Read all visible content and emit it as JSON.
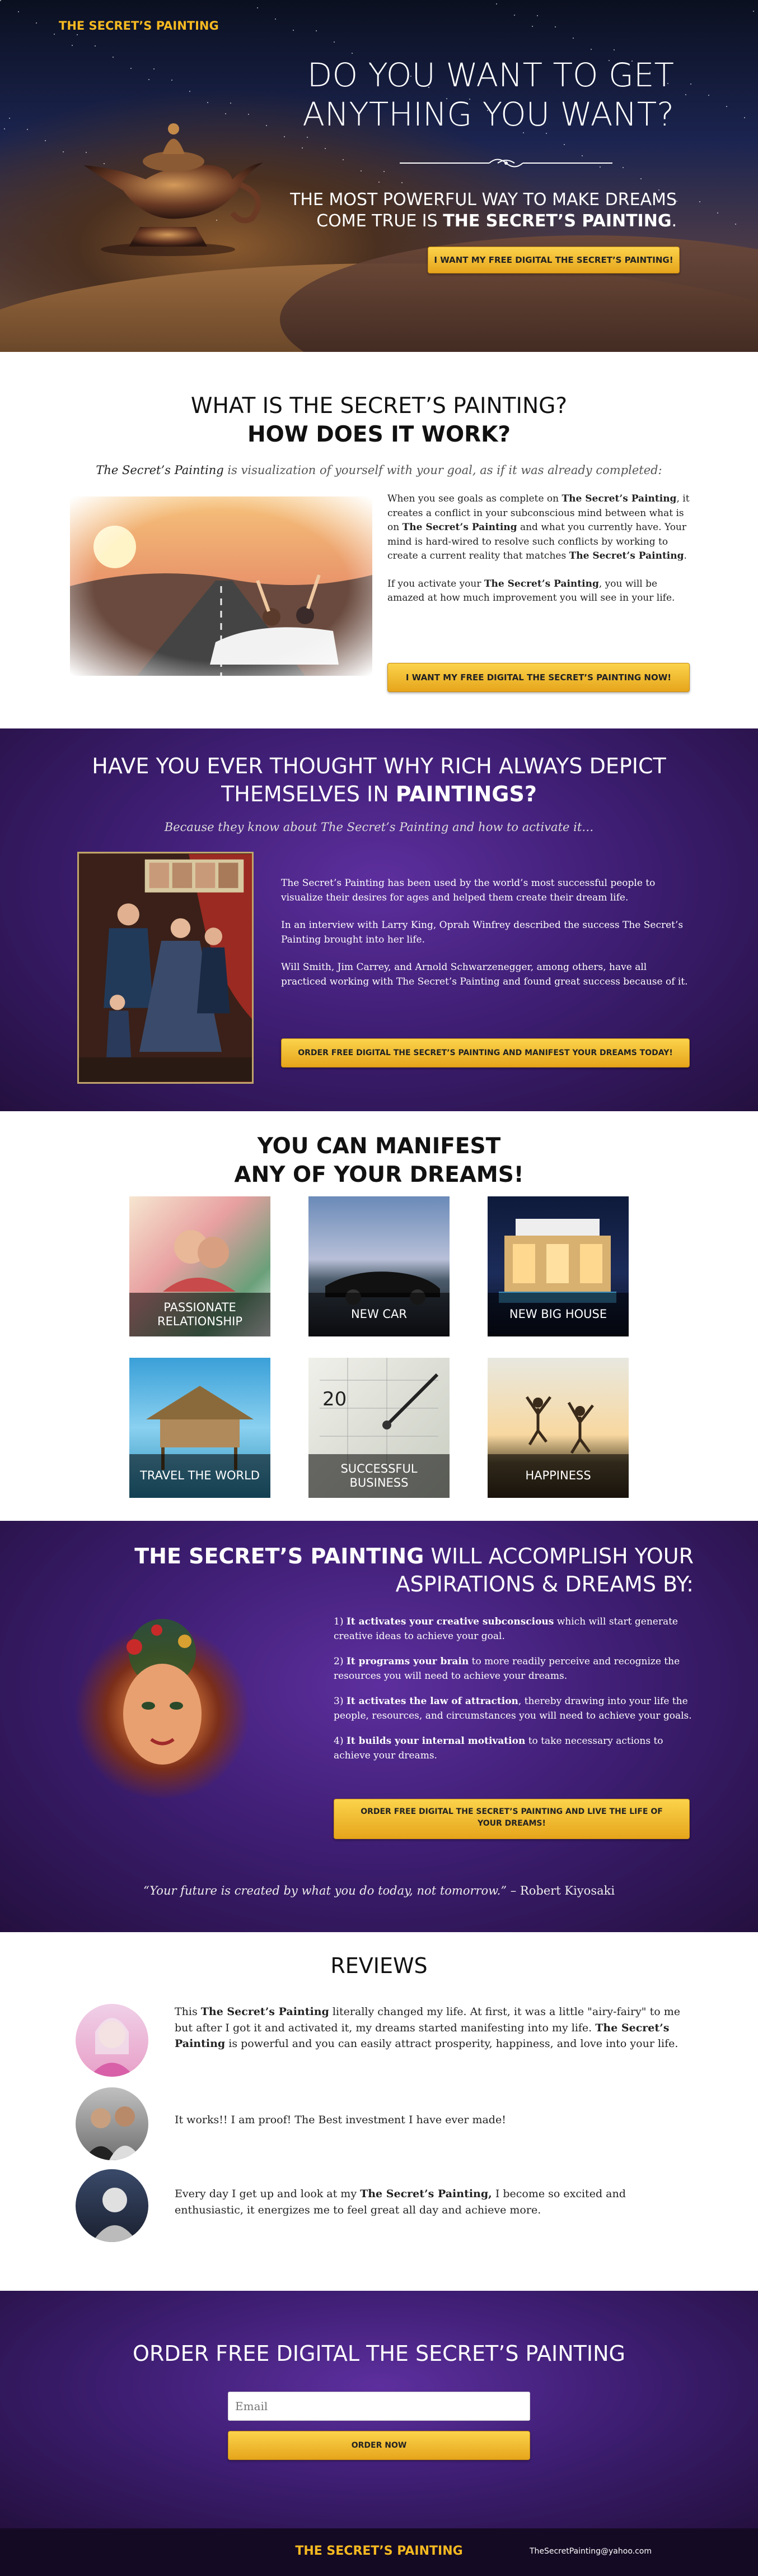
{
  "hero": {
    "brand": "THE SECRET’S PAINTING",
    "title_line1": "DO YOU WANT TO GET",
    "title_line2": "ANYTHING YOU WANT?",
    "sub_line1": "THE MOST POWERFUL WAY TO MAKE DREAMS",
    "sub_line2_pre": "COME TRUE IS ",
    "sub_line2_bold": "THE SECRET’S PAINTING",
    "sub_line2_post": ".",
    "cta": "I WANT MY FREE DIGITAL THE SECRET’S PAINTING!"
  },
  "whatis": {
    "title_line1": "WHAT IS THE SECRET’S PAINTING?",
    "title_line2": "HOW DOES IT WORK?",
    "lead_em": "The Secret’s Painting",
    "lead_rest": " is visualization of yourself with your goal, as if it was already completed:",
    "p1": [
      {
        "t": "When you see goals as complete on "
      },
      {
        "b": "The Secret’s Painting"
      },
      {
        "t": ", it creates a conflict in your subconscious mind between what is on "
      },
      {
        "b": "The Secret’s Painting"
      },
      {
        "t": " and what you currently have. Your mind is hard-wired to resolve such conflicts by working to create a current reality that matches "
      },
      {
        "b": "The Secret’s Painting"
      },
      {
        "t": "."
      }
    ],
    "p2": [
      {
        "t": "If you activate your "
      },
      {
        "b": "The Secret’s Painting"
      },
      {
        "t": ", you will be amazed at how much improvement you will see in your life."
      }
    ],
    "cta": "I WANT MY FREE DIGITAL THE SECRET’S PAINTING NOW!"
  },
  "rich": {
    "title_line1": "HAVE YOU EVER THOUGHT WHY RICH ALWAYS DEPICT",
    "title_line2_pre": "THEMSELVES IN ",
    "title_line2_bold": "PAINTINGS?",
    "lead_pre": "Because they know about ",
    "lead_em": "The Secret’s Painting",
    "lead_post": " and how to activate it…",
    "p1": "The Secret’s Painting has been used by the world’s most successful people to visualize their desires for ages and helped them create their dream life.",
    "p2": "In an interview with Larry King, Oprah Winfrey described the success The Secret’s Painting brought into her life.",
    "p3": "Will Smith, Jim Carrey, and Arnold Schwarzenegger, among others, have all practiced working with The Secret’s Painting and found great success because of it.",
    "cta": "ORDER FREE DIGITAL THE SECRET’S PAINTING AND MANIFEST YOUR DREAMS TODAY!"
  },
  "manifest": {
    "title_line1": "YOU CAN MANIFEST",
    "title_line2": "ANY OF YOUR DREAMS!",
    "tiles": [
      {
        "label": "PASSIONATE RELATIONSHIP"
      },
      {
        "label": "NEW CAR"
      },
      {
        "label": "NEW BIG HOUSE"
      },
      {
        "label": "TRAVEL THE WORLD"
      },
      {
        "label": "SUCCESSFUL BUSINESS"
      },
      {
        "label": "HAPPINESS"
      }
    ]
  },
  "accomplish": {
    "title_bold": "THE SECRET’S PAINTING",
    "title_rest1": " WILL ACCOMPLISH YOUR",
    "title_line2": "ASPIRATIONS & DREAMS BY:",
    "items": [
      {
        "num": "1) ",
        "bold": "It activates your creative subconscious",
        "rest": " which will start generate creative ideas to achieve your goal."
      },
      {
        "num": "2) ",
        "bold": "It programs your brain",
        "rest": " to more readily perceive and recognize the resources you will need to achieve your dreams."
      },
      {
        "num": "3) ",
        "bold": "It activates the law of attraction",
        "rest": ", thereby drawing into your life the people, resources, and circumstances you will need to achieve your goals."
      },
      {
        "num": "4) ",
        "bold": "It builds your internal motivation",
        "rest": " to take necessary actions to achieve your dreams."
      }
    ],
    "cta_line1": "ORDER FREE DIGITAL THE SECRET’S PAINTING AND LIVE THE LIFE OF",
    "cta_line2": "YOUR DREAMS!",
    "quote_em": "“Your future is created by what you do today, not tomorrow.”",
    "quote_author": " – Robert Kiyosaki"
  },
  "reviews": {
    "title": "REVIEWS",
    "items": [
      {
        "parts": [
          {
            "t": "This "
          },
          {
            "b": "The Secret’s Painting"
          },
          {
            "t": " literally changed my life. At first, it was a little \"airy-fairy\" to me but after I got it and activated it, my dreams started manifesting into my life. "
          },
          {
            "b": "The Secret’s Painting"
          },
          {
            "t": " is powerful and you can easily attract prosperity, happiness, and love into your life."
          }
        ]
      },
      {
        "parts": [
          {
            "t": "It works!! I am proof! The Best investment I have ever made!"
          }
        ]
      },
      {
        "parts": [
          {
            "t": "Every day I get up and look at my "
          },
          {
            "b": "The Secret’s Painting,"
          },
          {
            "t": " I become so excited and enthusiastic, it energizes me to feel great all day and achieve more."
          }
        ]
      }
    ]
  },
  "order": {
    "title": "ORDER FREE DIGITAL THE SECRET’S PAINTING",
    "email_placeholder": "Email",
    "cta": "ORDER NOW"
  },
  "footer": {
    "brand": "THE SECRET’S PAINTING",
    "email": "TheSecretPainting@yahoo.com"
  },
  "colors": {
    "gold": "#f5b921",
    "purple": "#3c1d70",
    "footer": "#150a24"
  }
}
